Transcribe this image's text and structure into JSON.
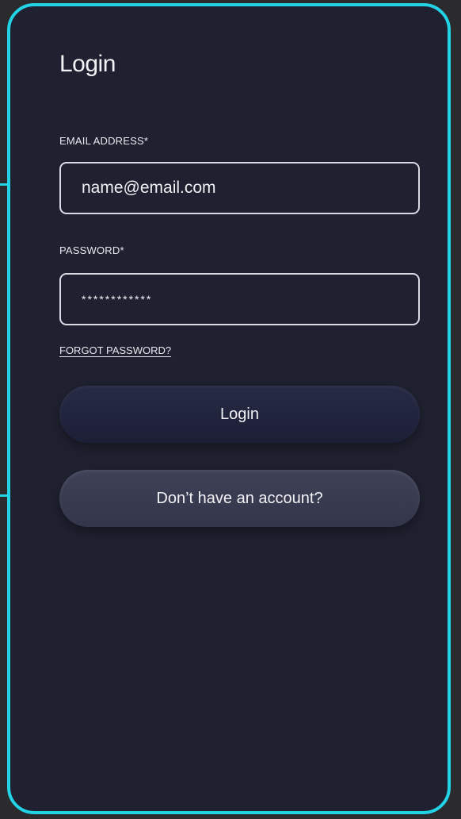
{
  "screen": {
    "title": "Login"
  },
  "form": {
    "email_label": "EMAIL ADDRESS*",
    "email_value": "name@email.com",
    "password_label": "PASSWORD*",
    "password_value": "************",
    "forgot_link": "FORGOT PASSWORD?"
  },
  "actions": {
    "login_label": "Login",
    "signup_label": "Don’t have an account?"
  },
  "colors": {
    "accent_outline": "#22d3e6",
    "background": "#1f2130",
    "text": "#f2f2f5"
  }
}
